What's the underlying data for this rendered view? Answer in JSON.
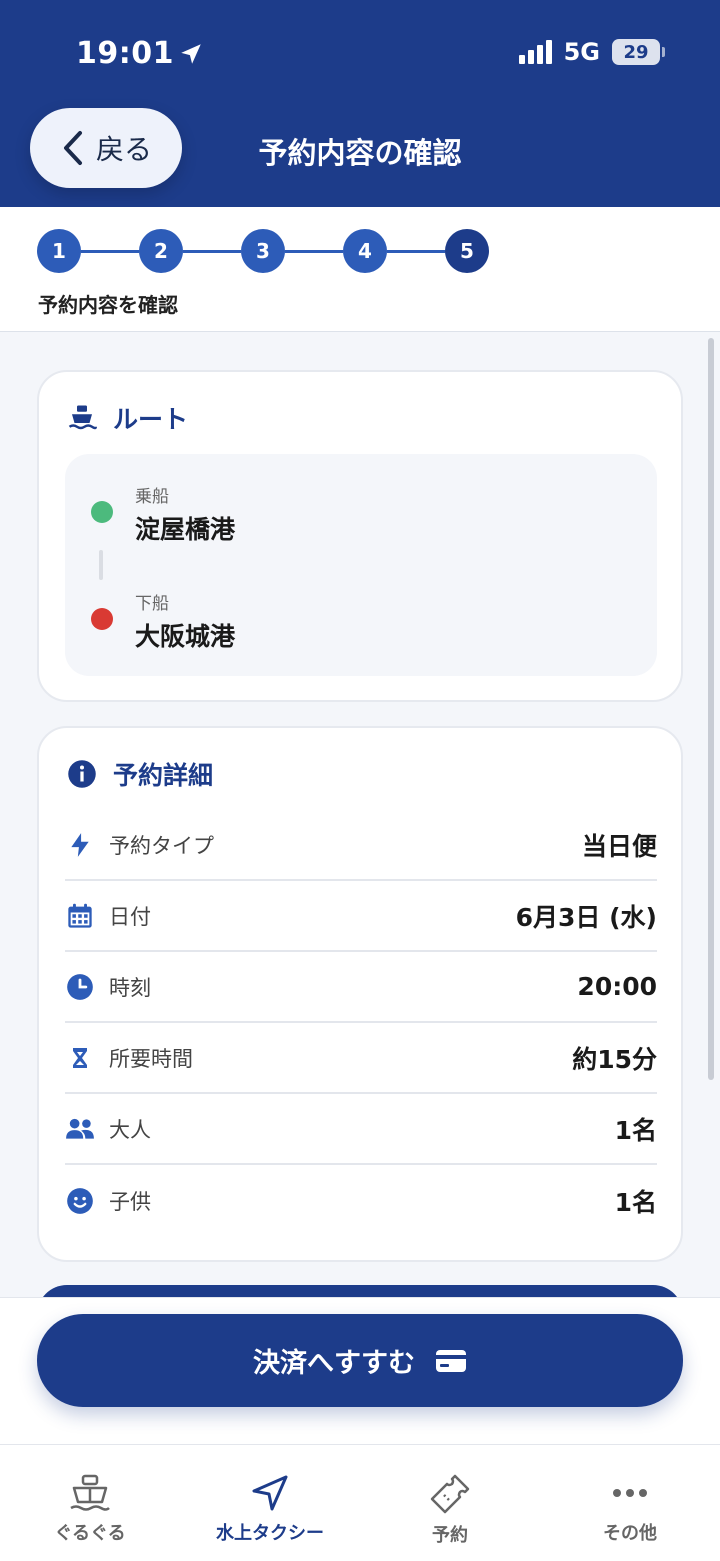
{
  "status_bar": {
    "time": "19:01",
    "network": "5G",
    "battery": "29"
  },
  "header": {
    "back_label": "戻る",
    "title": "予約内容の確認"
  },
  "stepper": {
    "steps": [
      "1",
      "2",
      "3",
      "4",
      "5"
    ],
    "current_step": 5,
    "caption": "予約内容を確認"
  },
  "route": {
    "title": "ルート",
    "boarding_label": "乗船",
    "boarding_port": "淀屋橋港",
    "alighting_label": "下船",
    "alighting_port": "大阪城港"
  },
  "details": {
    "title": "予約詳細",
    "rows": [
      {
        "label": "予約タイプ",
        "value": "当日便",
        "icon": "bolt-icon"
      },
      {
        "label": "日付",
        "value": "6月3日 (水)",
        "icon": "calendar-icon"
      },
      {
        "label": "時刻",
        "value": "20:00",
        "icon": "clock-icon"
      },
      {
        "label": "所要時間",
        "value": "約15分",
        "icon": "hourglass-icon"
      },
      {
        "label": "大人",
        "value": "1名",
        "icon": "people-icon"
      },
      {
        "label": "子供",
        "value": "1名",
        "icon": "child-icon"
      }
    ]
  },
  "action": {
    "pay_label": "決済へすすむ"
  },
  "tabs": [
    {
      "label": "ぐるぐる",
      "icon": "boat-icon"
    },
    {
      "label": "水上タクシー",
      "icon": "navigation-icon",
      "active": true
    },
    {
      "label": "予約",
      "icon": "ticket-icon"
    },
    {
      "label": "その他",
      "icon": "more-icon"
    }
  ],
  "colors": {
    "primary": "#1d3c8a",
    "step": "#2d5cb8",
    "boarding": "#4cba7d",
    "alighting": "#d93a33"
  }
}
